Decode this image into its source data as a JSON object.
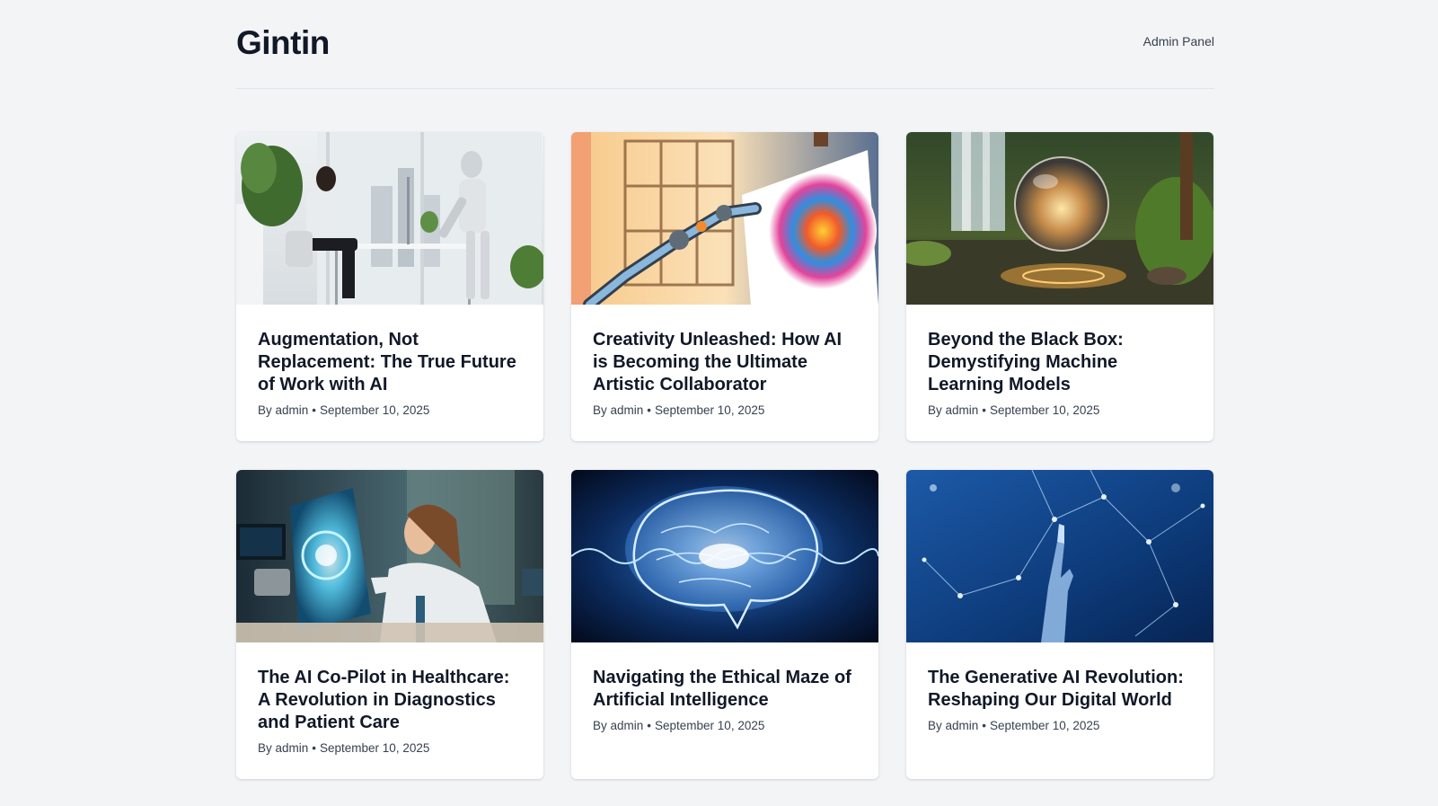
{
  "site": {
    "logo": "Gintin",
    "admin_link": "Admin Panel"
  },
  "posts": [
    {
      "title": "Augmentation, Not Replacement: The True Future of Work with AI",
      "author_prefix": "By admin",
      "separator": "•",
      "date": "September 10, 2025",
      "image": "woman-and-robot-at-desks-image"
    },
    {
      "title": "Creativity Unleashed: How AI is Becoming the Ultimate Artistic Collaborator",
      "author_prefix": "By admin",
      "separator": "•",
      "date": "September 10, 2025",
      "image": "robot-arm-painting-canvas-image"
    },
    {
      "title": "Beyond the Black Box: Demystifying Machine Learning Models",
      "author_prefix": "By admin",
      "separator": "•",
      "date": "September 10, 2025",
      "image": "glass-sphere-by-waterfall-image"
    },
    {
      "title": "The AI Co-Pilot in Healthcare: A Revolution in Diagnostics and Patient Care",
      "author_prefix": "By admin",
      "separator": "•",
      "date": "September 10, 2025",
      "image": "doctor-with-holographic-display-image"
    },
    {
      "title": "Navigating the Ethical Maze of Artificial Intelligence",
      "author_prefix": "By admin",
      "separator": "•",
      "date": "September 10, 2025",
      "image": "glowing-digital-brain-image"
    },
    {
      "title": "The Generative AI Revolution: Reshaping Our Digital World",
      "author_prefix": "By admin",
      "separator": "•",
      "date": "September 10, 2025",
      "image": "robot-hand-network-image"
    }
  ],
  "colors": {
    "background": "#f3f4f6",
    "card": "#ffffff",
    "text": "#111827",
    "meta": "#374151"
  }
}
